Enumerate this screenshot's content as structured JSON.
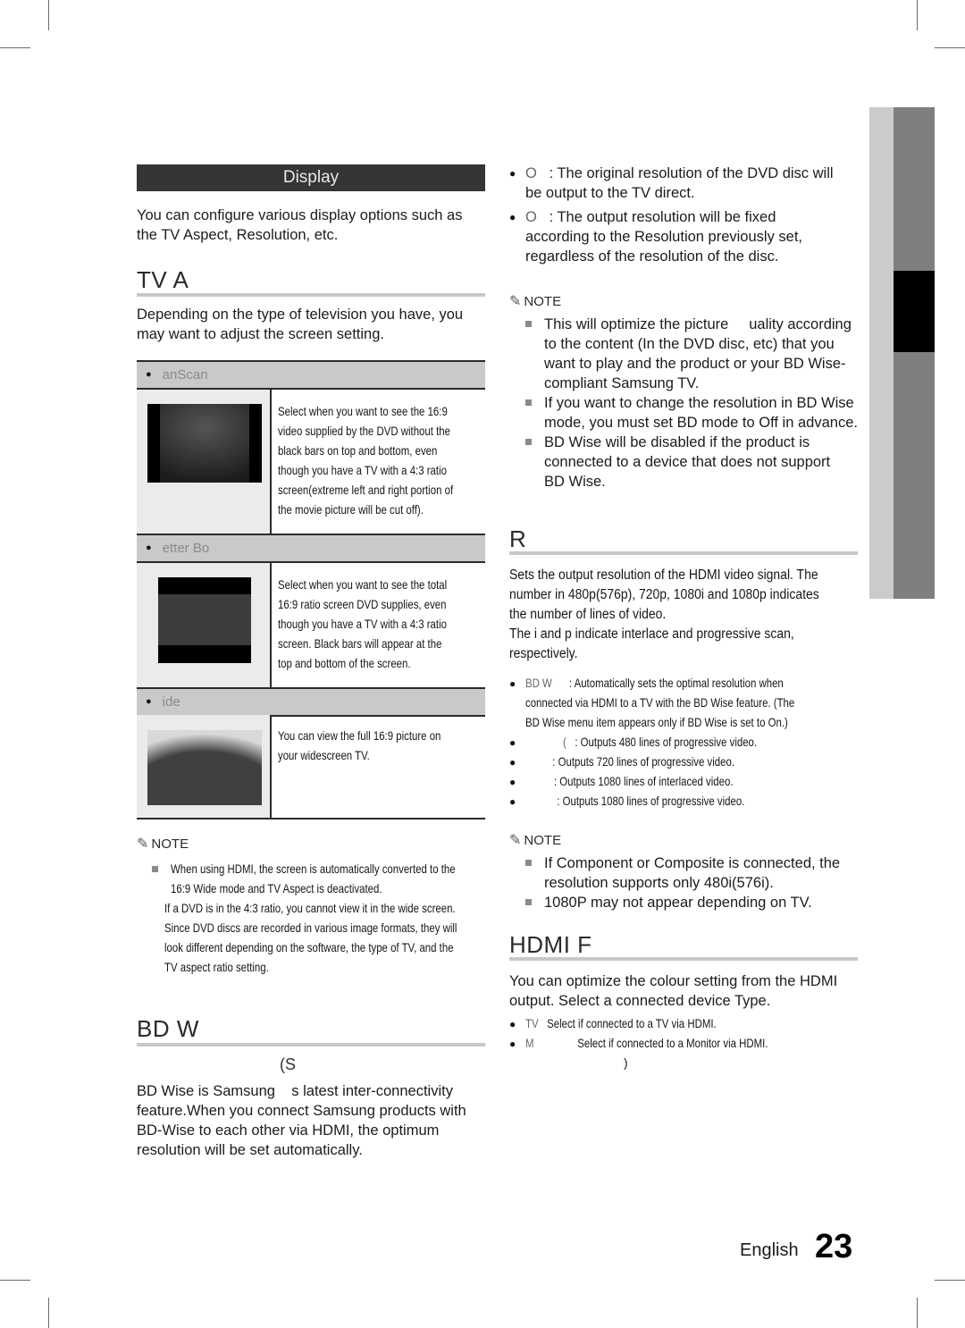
{
  "section_header": "Display",
  "intro": [
    "You can configure various display options such as",
    "the TV Aspect, Resolution, etc."
  ],
  "tv_aspect": {
    "heading": "TV A",
    "intro": [
      "Depending on the type of television you have, you",
      "may want to adjust the screen setting."
    ],
    "options": [
      {
        "label": "anScan",
        "icon": "pan-scan-screen-icon",
        "desc": [
          "Select when you want to see the 16:9",
          "video supplied by the DVD without the",
          "black bars on top and bottom, even",
          "though you have a TV with a 4:3 ratio",
          "screen(extreme left and right portion of",
          "the movie picture will be cut off)."
        ]
      },
      {
        "label": "etter Bo",
        "icon": "letter-box-screen-icon",
        "desc": [
          "Select when you want to see the total",
          "16:9 ratio screen DVD supplies, even",
          "though you have a TV with a 4:3 ratio",
          "screen. Black bars will appear at the",
          "top and bottom of the screen."
        ]
      },
      {
        "label": "ide",
        "icon": "wide-screen-icon",
        "desc": [
          "You can view the full 16:9 picture on",
          "your widescreen TV."
        ]
      }
    ],
    "note_label": "NOTE",
    "notes": [
      [
        "When using HDMI, the screen is automatically converted to the",
        "16:9 Wide mode and TV Aspect is deactivated."
      ],
      [
        "If a DVD is in the 4:3 ratio, you cannot view it in the wide screen."
      ],
      [
        "Since DVD discs are recorded in various image formats, they will",
        "look different depending on the software, the type of TV, and the",
        "TV aspect ratio setting."
      ]
    ]
  },
  "bd_wise": {
    "heading": "BD W",
    "subheading": "(S",
    "body": [
      "BD Wise is Samsung    s latest inter-connectivity",
      "feature.When you connect Samsung products with",
      "BD-Wise to each other via HDMI, the optimum",
      "resolution will be set automatically."
    ],
    "options": [
      {
        "term": "O",
        "lines": [
          ": The original resolution of the DVD disc will",
          "be output to the TV direct."
        ]
      },
      {
        "term": "O",
        "lines": [
          ": The output resolution will be fixed",
          "according to the Resolution previously set,",
          "regardless of the resolution of the disc."
        ]
      }
    ],
    "note_label": "NOTE",
    "notes": [
      [
        "This will optimize the picture     uality according",
        "to the content (In the DVD disc, etc) that you",
        "want to play and the product or your BD Wise-",
        "compliant Samsung TV."
      ],
      [
        "If you want to change the resolution in BD Wise",
        "mode, you must set BD mode to Off in advance."
      ],
      [
        "BD Wise will be disabled if the product is",
        "connected to a device that does not support",
        "BD Wise."
      ]
    ]
  },
  "resolution": {
    "heading": "R",
    "body": [
      "Sets the output resolution of the HDMI video signal. The",
      "number in 480p(576p), 720p, 1080i and 1080p indicates",
      "the number of lines of video.",
      "The i and p indicate interlace and progressive scan,",
      "respectively."
    ],
    "options": [
      {
        "term": "BD W",
        "lines": [
          ": Automatically sets the optimal resolution when",
          "connected via HDMI to a TV with the BD Wise feature. (The",
          "BD Wise menu item appears only if BD Wise is set to On.)"
        ]
      },
      {
        "term": "(",
        "lines": [
          ": Outputs 480 lines of progressive video."
        ]
      },
      {
        "term": "",
        "lines": [
          ": Outputs 720 lines of progressive video."
        ]
      },
      {
        "term": "",
        "lines": [
          ": Outputs 1080 lines of interlaced video."
        ]
      },
      {
        "term": "",
        "lines": [
          ": Outputs 1080 lines of progressive video."
        ]
      }
    ],
    "note_label": "NOTE",
    "notes": [
      [
        "If Component or Composite is connected, the",
        "resolution supports only 480i(576i)."
      ],
      [
        "1080P may not appear depending on TV."
      ]
    ]
  },
  "hdmi_format": {
    "heading": "HDMI F",
    "body": [
      "You can optimize the colour setting from the HDMI",
      "output. Select a connected device Type."
    ],
    "options": [
      {
        "term": "TV",
        "text": "Select if connected to a TV via HDMI."
      },
      {
        "term": "M",
        "text": "Select if connected to a Monitor via HDMI."
      }
    ],
    "trailing": ")"
  },
  "footer": {
    "language": "English",
    "page_number": "23"
  }
}
